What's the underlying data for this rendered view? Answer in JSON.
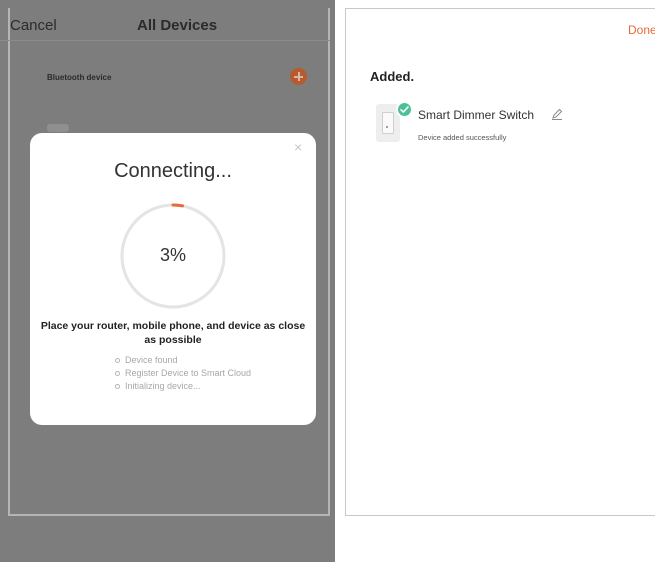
{
  "left": {
    "header": {
      "cancel_label": "Cancel",
      "title": "All Devices"
    },
    "section_label": "Bluetooth device",
    "dialog": {
      "title": "Connecting...",
      "progress_percent": 3,
      "progress_label": "3%",
      "tip": "Place your router, mobile phone, and device as close as possible",
      "steps": [
        "Device found",
        "Register Device to Smart Cloud",
        "Initializing device..."
      ]
    }
  },
  "right": {
    "done_label": "Done",
    "heading": "Added.",
    "device": {
      "name": "Smart Dimmer Switch",
      "status": "Device added successfully"
    }
  },
  "colors": {
    "accent": "#ea6a3a",
    "success": "#4fbf96",
    "overlay": "#7d7d7d"
  }
}
